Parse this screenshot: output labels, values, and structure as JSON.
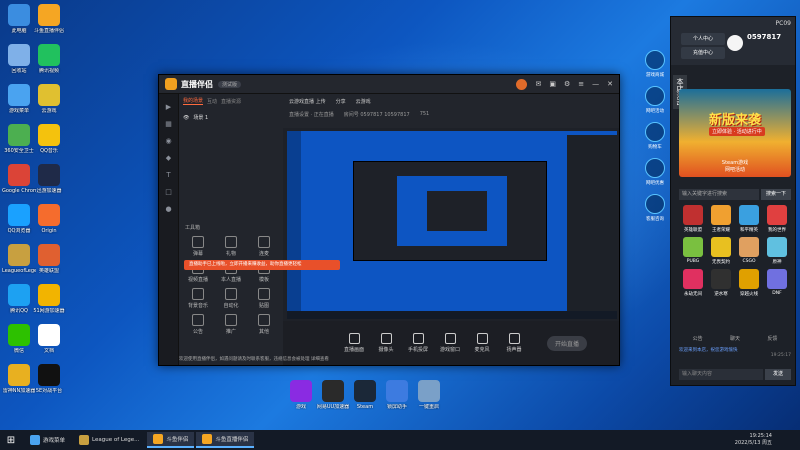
{
  "desktop": {
    "icons_left": [
      {
        "label": "此电脑",
        "color": "#3b8de0"
      },
      {
        "label": "斗鱼直播伴侣",
        "color": "#f5a623"
      },
      {
        "label": "回收站",
        "color": "#7fb0e8"
      },
      {
        "label": "腾讯视频",
        "color": "#21c15e"
      },
      {
        "label": "游戏菜单",
        "color": "#4aa3f0"
      },
      {
        "label": "云游戏",
        "color": "#e0c030"
      },
      {
        "label": "360安全卫士",
        "color": "#4caf50"
      },
      {
        "label": "QQ音乐",
        "color": "#f4c20d"
      },
      {
        "label": "Google Chrome",
        "color": "#db4437"
      },
      {
        "label": "迅游加速器",
        "color": "#1f2a48"
      },
      {
        "label": "QQ浏览器",
        "color": "#1aa1ff"
      },
      {
        "label": "Origin",
        "color": "#f56c2d"
      },
      {
        "label": "LeagueofLegends",
        "color": "#c8a040"
      },
      {
        "label": "英雄联盟",
        "color": "#e06030"
      },
      {
        "label": "腾讯QQ",
        "color": "#1da1f2"
      },
      {
        "label": "51网游加速器",
        "color": "#f2b400"
      },
      {
        "label": "微信",
        "color": "#2dc100"
      },
      {
        "label": "文档",
        "color": "#ffffff"
      },
      {
        "label": "雷神NN加速器",
        "color": "#e8b020"
      },
      {
        "label": "5E对战平台",
        "color": "#111111"
      }
    ],
    "icons_bottom": [
      {
        "label": "游戏",
        "color": "#8a2be2"
      },
      {
        "label": "网易UU加速器",
        "color": "#2a2a2a"
      },
      {
        "label": "Steam",
        "color": "#1b2838"
      },
      {
        "label": "锁屏助手",
        "color": "#3d7be0"
      },
      {
        "label": "一键重启",
        "color": "#7aa0c8"
      }
    ]
  },
  "app": {
    "title": "直播伴侣",
    "version": "测试版",
    "scene_tabs": [
      "我的场景",
      "互动",
      "直播资源"
    ],
    "scene_item": "场景 1",
    "tools_title": "工具箱",
    "tools": [
      "弹幕",
      "礼物",
      "连麦",
      "视频直播",
      "本人直播",
      "模板",
      "背景音乐",
      "自动化",
      "贴图",
      "公告",
      "推广",
      "其他"
    ],
    "header_row1": [
      "云游戏直播 上传",
      "分享",
      "云游戏"
    ],
    "header_row2": [
      "直播设置 · 正在直播",
      "房间号 0597817 10597817",
      "751"
    ],
    "bottom_buttons": [
      "直播画面",
      "摄像头",
      "手机投屏",
      "游戏窗口",
      "麦克风",
      "扬声器"
    ],
    "golive": "开始直播",
    "tip": "直播助手已上线啦，立即开播来赚收益，助你直播更轻松",
    "notice": "欢迎使用直播伴侣，如遇问题请及时联系客服，违规信息会被处理 详细查看"
  },
  "rightpanel": {
    "pcid": "PC09",
    "user_center": "个人中心",
    "charge_center": "充值中心",
    "room_id": "0597817",
    "side_tab": "本店活动",
    "banner_title": "新版来袭",
    "banner_tag": "立即体验 · 活动进行中",
    "banner_caption": "Steam游戏",
    "banner_sub": "网吧活动",
    "search_placeholder": "输入关键字进行搜索",
    "search_button": "搜索一下",
    "games": [
      {
        "label": "英雄联盟",
        "color": "#c03030"
      },
      {
        "label": "王者荣耀",
        "color": "#f0a030"
      },
      {
        "label": "和平精英",
        "color": "#3aa0e0"
      },
      {
        "label": "我的世界",
        "color": "#e04040"
      },
      {
        "label": "PUBG",
        "color": "#7ac040"
      },
      {
        "label": "无畏契约",
        "color": "#e8c020"
      },
      {
        "label": "CSGO",
        "color": "#e0a060"
      },
      {
        "label": "原神",
        "color": "#60c0e0"
      },
      {
        "label": "永劫无间",
        "color": "#e03060"
      },
      {
        "label": "逆水寒",
        "color": "#303030"
      },
      {
        "label": "穿越火线",
        "color": "#e0a000"
      },
      {
        "label": "DNF",
        "color": "#7070e0"
      }
    ],
    "tabs": [
      "公告",
      "聊天",
      "反馈"
    ],
    "chat_msg": "欢迎来到本店，祝您游戏愉快",
    "chat_time": "19:25:17",
    "chat_placeholder": "输入聊天内容",
    "send": "发送"
  },
  "sidebuttons": [
    "游戏商城",
    "网吧活动",
    "购物车",
    "网吧优惠",
    "客服咨询"
  ],
  "taskbar": {
    "items": [
      {
        "label": "游戏菜单",
        "color": "#4aa3f0",
        "active": false
      },
      {
        "label": "League of Lege...",
        "color": "#c8a040",
        "active": false
      },
      {
        "label": "斗鱼伴侣",
        "color": "#f5a623",
        "active": true
      },
      {
        "label": "斗鱼直播伴侣",
        "color": "#f5a623",
        "active": true
      }
    ],
    "time": "19:25:14",
    "date": "2022/5/13 周五"
  }
}
